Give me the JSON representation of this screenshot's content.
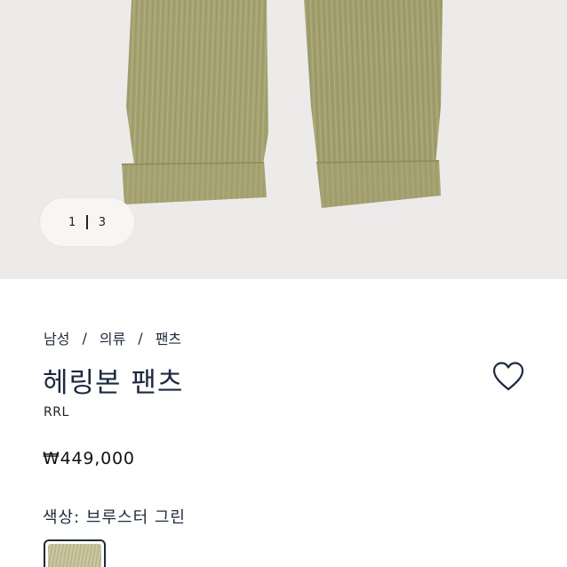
{
  "gallery": {
    "current_page": "1",
    "total_pages": "3"
  },
  "breadcrumb": [
    "남성",
    "의류",
    "팬츠"
  ],
  "product": {
    "title": "헤링본 팬츠",
    "brand": "RRL",
    "price": "₩449,000",
    "color_label": "색상: 브루스터 그린"
  },
  "colors": {
    "pants": "#a4a170",
    "background": "#ecebe9",
    "text_navy": "#1b2a44"
  },
  "icons": {
    "wishlist": "heart-outline-icon"
  }
}
